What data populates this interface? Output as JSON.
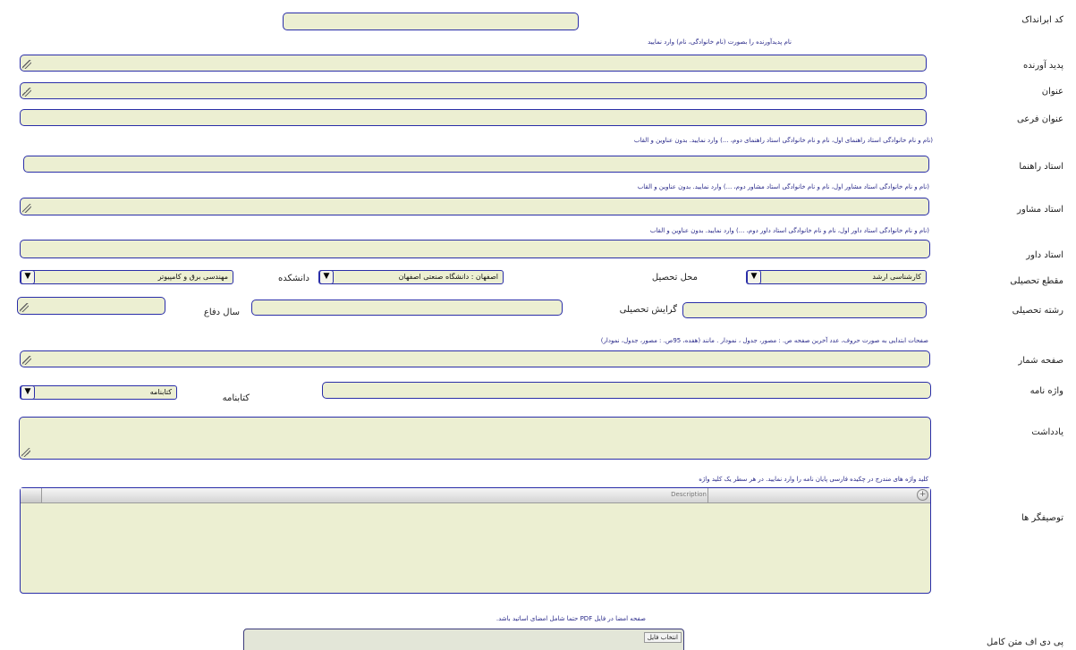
{
  "labels": {
    "code": "کد ابرانداک",
    "creator": "پدید آورنده",
    "title": "عنوان",
    "subtitle": "عنوان فرعی",
    "supervisor": "استاد راهنما",
    "advisor": "استاد مشاور",
    "referee": "استاد داور",
    "degree": "مقطع تحصیلی",
    "place": "محل تحصیل",
    "faculty": "دانشکده",
    "major": "رشته تحصیلی",
    "specialty": "گرایش تحصیلی",
    "defense_year": "سال دفاع",
    "pages": "صفحه شمار",
    "glossary": "واژه نامه",
    "bibliography": "کتابنامه",
    "notes": "یادداشت",
    "descriptors": "توصیفگر ها",
    "fulltext_pdf": "پی دی اف متن کامل"
  },
  "hints": {
    "creator": "نام پدیدآورنده را بصورت (نام خانوادگی، نام) وارد نمایید",
    "supervisor": "(نام و نام خانوادگی استاد راهنمای اول، نام و نام خانوادگی استاد راهنمای دوم، ...) وارد نمایید. بدون عناوین و القاب",
    "advisor": "(نام و نام خانوادگی استاد مشاور اول، نام و نام خانوادگی استاد مشاور دوم، ...) وارد نمایید. بدون عناوین و القاب",
    "referee": "(نام و نام خانوادگی استاد داور اول، نام و نام خانوادگی استاد داور دوم، ...) وارد نمایید. بدون عناوین و القاب",
    "pages": "صفحات ابتدایی به صورت حروف، عدد آخرین صفحه ص. : مصور، جدول ، نمودار . مانند (هفده، 95ص. : مصور، جدول، نمودار)",
    "descriptors": "کلید واژه های مندرج در چکیده فارسی پایان نامه را وارد نمایید. در هر سطر یک کلید واژه",
    "pdf": "صفحه امضا در فایل PDF حتما شامل امضای اساتید باشد."
  },
  "selects": {
    "degree": "کارشناسی ارشد",
    "place": "اصفهان : دانشگاه صنعتی اصفهان",
    "faculty": "مهندسی برق و کامپیوتر",
    "bibliography": "کتابنامه",
    "arrow": "▼"
  },
  "grid": {
    "column_header": "Description",
    "add_symbol": "+"
  },
  "file": {
    "button_label": "انتخاب فایل"
  }
}
